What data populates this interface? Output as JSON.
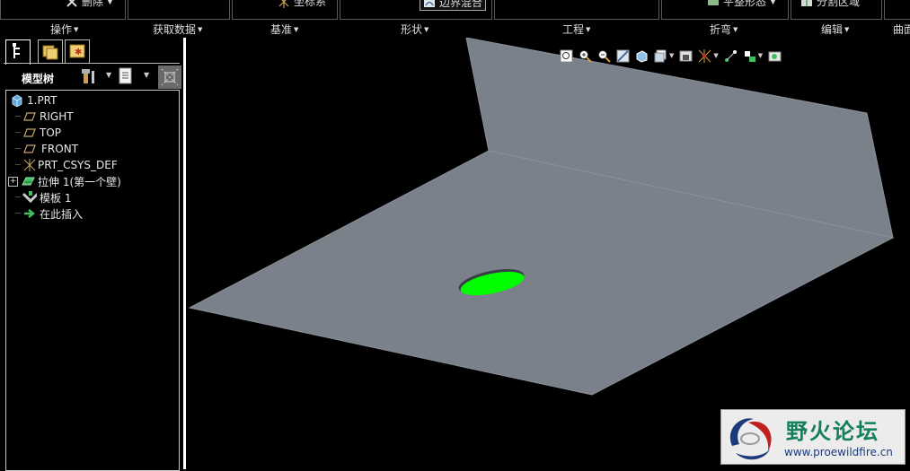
{
  "ribbon": {
    "commands": {
      "delete": "删除",
      "coord_sys": "坐标系",
      "blend": "边界混合",
      "flat_state": "平整形态",
      "split_area": "分割区域"
    },
    "groups": [
      "操作",
      "获取数据",
      "基准",
      "形状",
      "工程",
      "折弯",
      "编辑",
      "曲面"
    ]
  },
  "panel": {
    "title": "模型树",
    "tree": [
      {
        "label": "1.PRT",
        "icon": "part-icon"
      },
      {
        "label": "RIGHT",
        "icon": "datum-plane-icon"
      },
      {
        "label": "TOP",
        "icon": "datum-plane-icon"
      },
      {
        "label": "FRONT",
        "icon": "datum-plane-icon"
      },
      {
        "label": "PRT_CSYS_DEF",
        "icon": "csys-icon"
      },
      {
        "label": "拉伸 1(第一个壁)",
        "icon": "extrude-wall-icon"
      },
      {
        "label": "模板 1",
        "icon": "form-icon"
      },
      {
        "label": "在此插入",
        "icon": "insert-here-arrow-icon"
      }
    ]
  },
  "watermark": {
    "title": "野火论坛",
    "url": "www.proewildfire.cn"
  },
  "colors": {
    "surface": "#7b818a",
    "surface_edge": "#8a9099",
    "hole_fill": "#00ff00",
    "background": "#000000"
  }
}
